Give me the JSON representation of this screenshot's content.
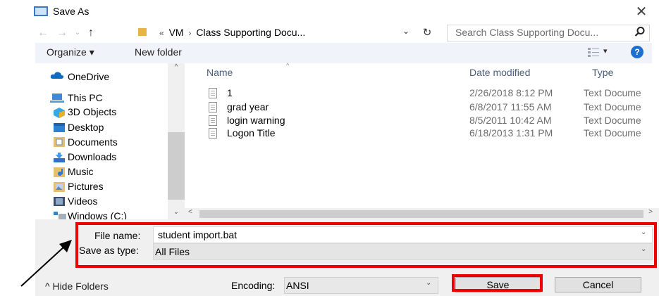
{
  "window": {
    "title": "Save As",
    "close_glyph": "✕"
  },
  "nav": {
    "back_glyph": "←",
    "forward_glyph": "→",
    "recent_glyph": "⌄",
    "up_glyph": "↑",
    "breadcrumb": [
      "VM",
      "Class Supporting Docu..."
    ],
    "overflow_glyph": "«",
    "separator_glyph": "›",
    "refresh_glyph": "↻",
    "dropdown_glyph": "⌄"
  },
  "search": {
    "placeholder": "Search Class Supporting Docu..."
  },
  "toolbar": {
    "organize": "Organize ▾",
    "new_folder": "New folder",
    "view_dropdown": "▾",
    "help": "?"
  },
  "sidebar": {
    "items": [
      {
        "label": "OneDrive",
        "icon": "onedrive-icon"
      },
      {
        "label": "This PC",
        "icon": "pc-icon"
      },
      {
        "label": "3D Objects",
        "icon": "objects-3d-icon"
      },
      {
        "label": "Desktop",
        "icon": "desktop-icon"
      },
      {
        "label": "Documents",
        "icon": "documents-icon"
      },
      {
        "label": "Downloads",
        "icon": "downloads-icon"
      },
      {
        "label": "Music",
        "icon": "music-icon"
      },
      {
        "label": "Pictures",
        "icon": "pictures-icon"
      },
      {
        "label": "Videos",
        "icon": "videos-icon"
      },
      {
        "label": "Windows (C:)",
        "icon": "drive-icon"
      }
    ]
  },
  "file_list": {
    "columns": [
      "Name",
      "Date modified",
      "Type"
    ],
    "sort_glyph": "^",
    "rows": [
      {
        "name": "1",
        "date": "2/26/2018 8:12 PM",
        "type": "Text Docume"
      },
      {
        "name": "grad year",
        "date": "6/8/2017 11:55 AM",
        "type": "Text Docume"
      },
      {
        "name": "login warning",
        "date": "8/5/2011 10:42 AM",
        "type": "Text Docume"
      },
      {
        "name": "Logon Title",
        "date": "6/18/2013 1:31 PM",
        "type": "Text Docume"
      }
    ]
  },
  "scroll": {
    "up": "^",
    "down": "⌄",
    "left": "<",
    "right": ">"
  },
  "fields": {
    "file_name_label": "File name:",
    "file_name_value": "student import.bat",
    "save_as_type_label": "Save as type:",
    "save_as_type_value": "All Files",
    "dropdown_glyph": "⌄"
  },
  "footer": {
    "hide_folders": "^ Hide Folders",
    "encoding_label": "Encoding:",
    "encoding_value": "ANSI",
    "save_label": "Save",
    "cancel_label": "Cancel"
  },
  "colors": {
    "highlight": "#ee0000",
    "accent": "#1e6fd0",
    "pane_bg": "#f0f0f0"
  }
}
